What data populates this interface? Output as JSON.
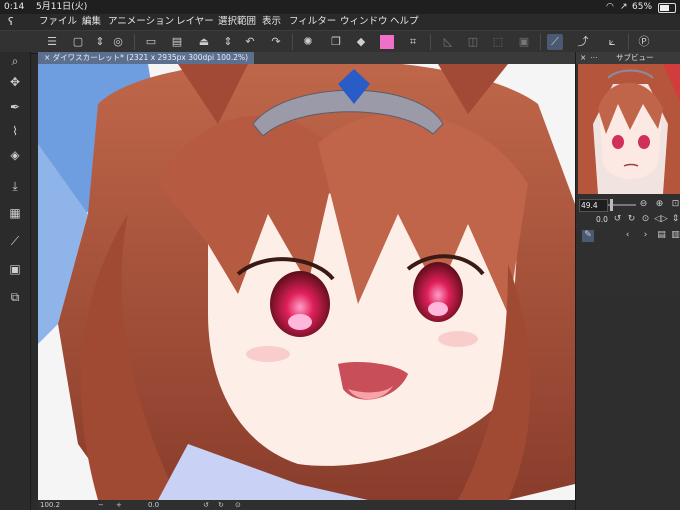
{
  "status_bar": {
    "time": "0:14",
    "date": "5月11日(火)",
    "battery": "65%"
  },
  "menu": [
    "ファイル",
    "編集",
    "アニメーション",
    "レイヤー",
    "選択範囲",
    "表示",
    "フィルター",
    "ウィンドウ",
    "ヘルプ"
  ],
  "document_tab": {
    "title": "ダイワスカーレット* (2321 x 2935px 300dpi 100.2%)"
  },
  "subview": {
    "title": "サブビュー",
    "zoom": "49.4",
    "rotation": "0.0"
  },
  "bottom_bar": {
    "zoom": "100.2",
    "rotation": "0.0"
  },
  "colors": {
    "accent": "#5b6f8f",
    "primary_color": "#f06fc8",
    "background": "#2b2b2b"
  }
}
